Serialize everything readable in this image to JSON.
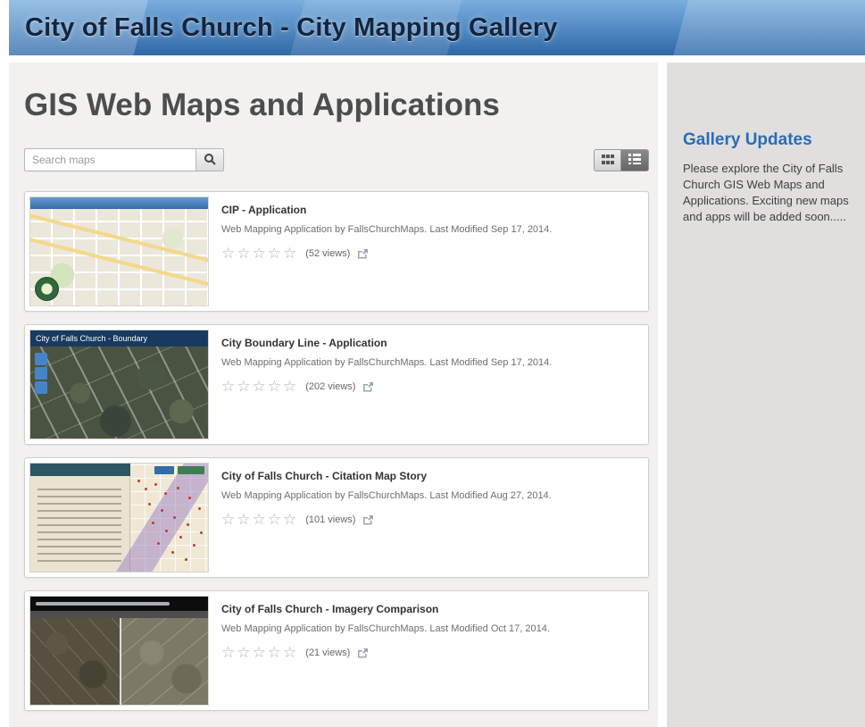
{
  "header": {
    "title": "City of Falls Church - City Mapping Gallery"
  },
  "main": {
    "page_title": "GIS Web Maps and Applications",
    "search": {
      "placeholder": "Search maps"
    }
  },
  "icons": {
    "empty_stars": "☆☆☆☆☆"
  },
  "cards": [
    {
      "title": "CIP - Application",
      "description": "Web Mapping Application by FallsChurchMaps. Last Modified Sep 17, 2014.",
      "views": "(52 views)"
    },
    {
      "title": "City Boundary Line - Application",
      "description": "Web Mapping Application by FallsChurchMaps. Last Modified Sep 17, 2014.",
      "views": "(202 views)",
      "thumb_label": "City of Falls Church - Boundary"
    },
    {
      "title": "City of Falls Church - Citation Map Story",
      "description": "Web Mapping Application by FallsChurchMaps. Last Modified Aug 27, 2014.",
      "views": "(101 views)"
    },
    {
      "title": "City of Falls Church - Imagery Comparison",
      "description": "Web Mapping Application by FallsChurchMaps. Last Modified Oct 17, 2014.",
      "views": "(21 views)"
    }
  ],
  "sidebar": {
    "title": "Gallery Updates",
    "text": "Please explore the City of Falls Church GIS Web Maps and Applications. Exciting new maps and apps will be added soon....."
  },
  "colors": {
    "header_blue": "#2f68a8",
    "accent_blue": "#2a6cb4",
    "star_gray": "#b4b4b4"
  }
}
